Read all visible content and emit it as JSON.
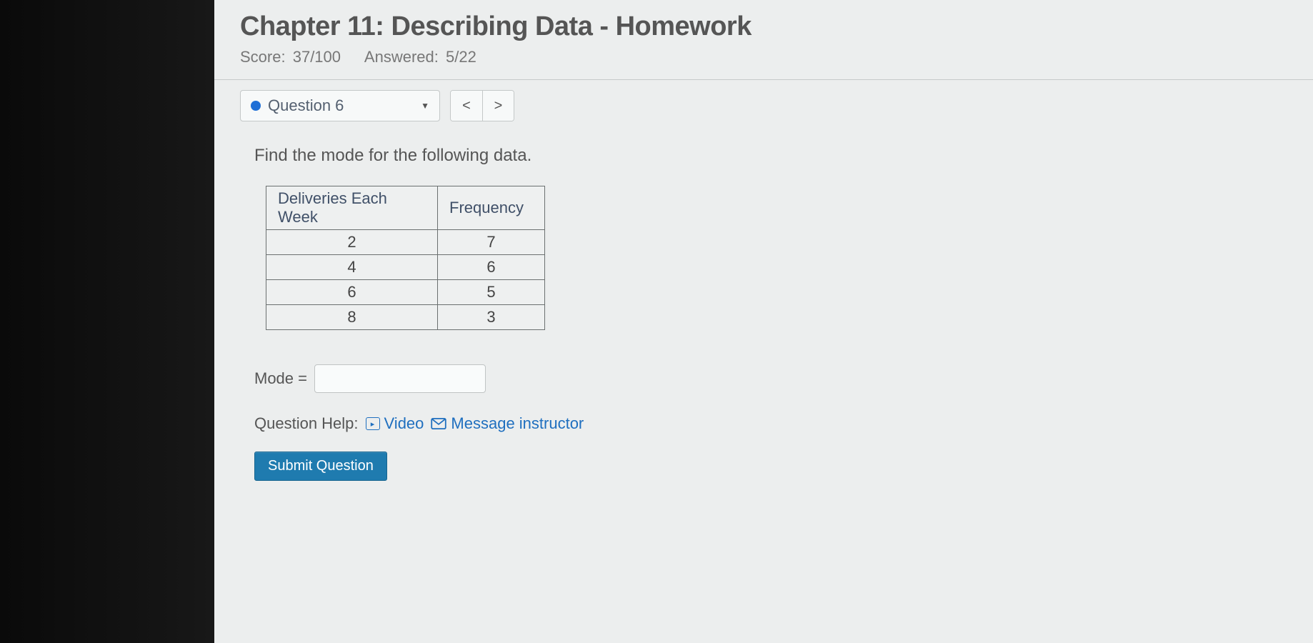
{
  "header": {
    "title": "Chapter 11: Describing Data - Homework",
    "score_label": "Score:",
    "score_value": "37/100",
    "answered_label": "Answered:",
    "answered_value": "5/22"
  },
  "nav": {
    "question_label": "Question 6",
    "prev_glyph": "<",
    "next_glyph": ">",
    "caret_glyph": "▼"
  },
  "question": {
    "prompt": "Find the mode for the following data.",
    "table": {
      "headers": [
        "Deliveries Each Week",
        "Frequency"
      ],
      "rows": [
        [
          "2",
          "7"
        ],
        [
          "4",
          "6"
        ],
        [
          "6",
          "5"
        ],
        [
          "8",
          "3"
        ]
      ]
    },
    "answer_label": "Mode =",
    "answer_value": ""
  },
  "help": {
    "label": "Question Help:",
    "video_label": "Video",
    "video_icon_glyph": "▸",
    "message_label": "Message instructor"
  },
  "submit": {
    "label": "Submit Question"
  }
}
